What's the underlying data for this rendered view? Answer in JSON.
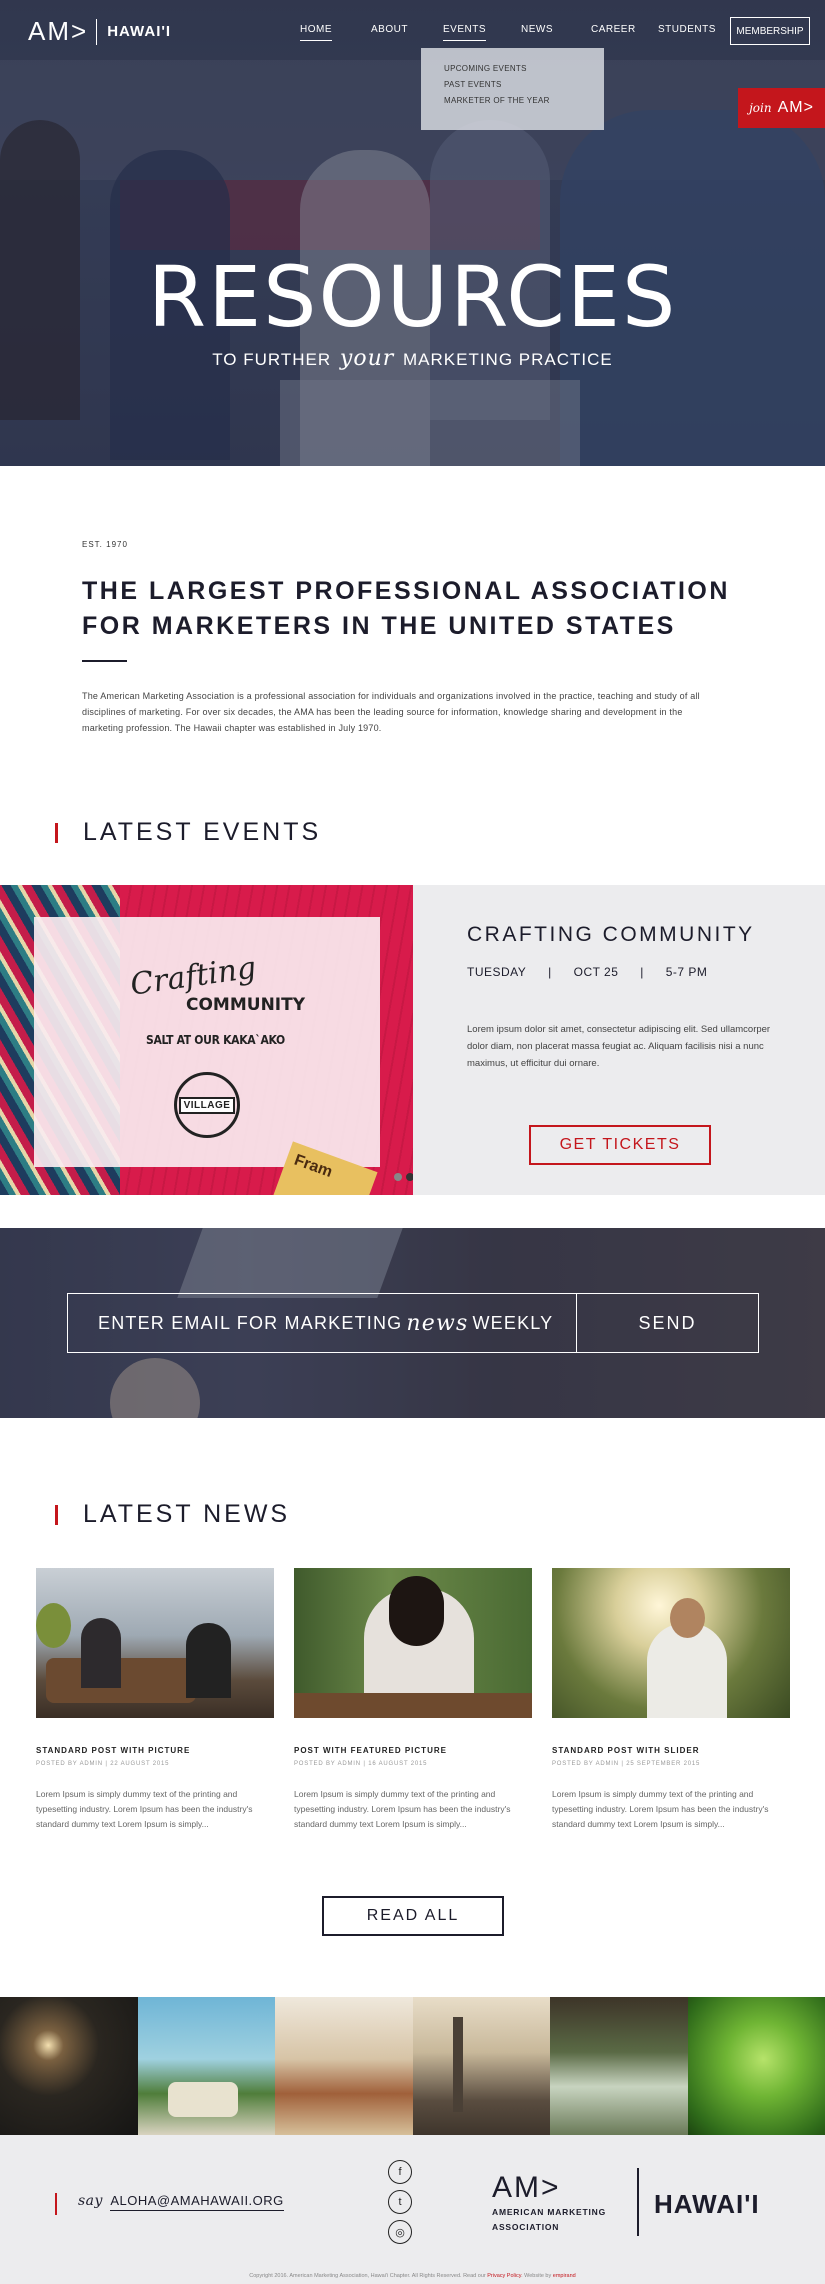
{
  "nav": {
    "logo_am": "AM>",
    "logo_hawaii": "HAWAI'I",
    "items": [
      "HOME",
      "ABOUT",
      "EVENTS",
      "NEWS",
      "CAREER",
      "STUDENTS"
    ],
    "membership": "MEMBERSHIP",
    "events_dropdown": [
      "UPCOMING EVENTS",
      "PAST EVENTS",
      "MARKETER OF THE YEAR"
    ],
    "join_script": "join",
    "join_logo": "AM>"
  },
  "hero": {
    "title": "RESOURCES",
    "sub_before": "TO FURTHER",
    "sub_script": "your",
    "sub_after": "MARKETING PRACTICE"
  },
  "intro": {
    "est": "EST. 1970",
    "heading": "THE LARGEST PROFESSIONAL ASSOCIATION FOR MARKETERS IN THE UNITED STATES",
    "body": "The American Marketing Association is a professional association for individuals and organizations involved in the practice, teaching and study of all disciplines of marketing. For over six decades, the AMA has been the leading source for information, knowledge sharing and development in the marketing profession. The Hawaii chapter was established in July 1970."
  },
  "events": {
    "section_title": "LATEST EVENTS",
    "poster_script": "Crafting",
    "poster_bold": "COMMUNITY",
    "poster_location": "SALT AT OUR KAKA`AKO",
    "poster_badge": "VILLAGE",
    "bottle_text": "Fram",
    "title": "CRAFTING COMMUNITY",
    "day": "TUESDAY",
    "date": "OCT  25",
    "time": "5-7 PM",
    "sep": "|",
    "description": "Lorem ipsum dolor sit amet, consectetur adipiscing elit. Sed ullamcorper dolor diam, non placerat massa feugiat ac. Aliquam facilisis nisi a nunc maximus, ut efficitur dui ornare.",
    "tickets_label": "GET TICKETS"
  },
  "newsletter": {
    "before": "ENTER EMAIL FOR MARKETING",
    "script": "news",
    "after": "WEEKLY",
    "send_label": "SEND"
  },
  "news": {
    "section_title": "LATEST NEWS",
    "posts": [
      {
        "title": "STANDARD POST WITH PICTURE",
        "meta": "POSTED BY ADMIN  |  22 AUGUST 2015",
        "excerpt": "Lorem Ipsum is simply dummy text of the printing and typesetting industry. Lorem Ipsum has been the industry's standard dummy text Lorem Ipsum is simply..."
      },
      {
        "title": "POST WITH FEATURED PICTURE",
        "meta": "POSTED BY ADMIN  |  16 AUGUST 2015",
        "excerpt": "Lorem Ipsum is simply dummy text of the printing and typesetting industry. Lorem Ipsum has been the industry's standard dummy text Lorem Ipsum is simply..."
      },
      {
        "title": "STANDARD POST WITH SLIDER",
        "meta": "POSTED BY ADMIN  |  25 SEPTEMBER 2015",
        "excerpt": "Lorem Ipsum is simply dummy text of the printing and typesetting industry. Lorem Ipsum has been the industry's standard dummy text Lorem Ipsum is simply..."
      }
    ],
    "read_all": "READ ALL"
  },
  "footer": {
    "say": "say",
    "email": "ALOHA@AMAHAWAII.ORG",
    "logo_am": "AM>",
    "logo_line1": "AMERICAN MARKETING",
    "logo_line2": "ASSOCIATION",
    "hawaii": "HAWAI'I",
    "social": [
      "f",
      "t",
      "◎"
    ],
    "copyright_main": "Copyright 2016. American Marketing Association, Hawai'i Chapter. All Rights Reserved. Read our",
    "privacy": "Privacy Policy",
    "copyright_end": ". Website by",
    "credit": "empirand"
  },
  "colors": {
    "accent": "#c4161c",
    "navy": "#1c1c2b",
    "panel": "#ececee"
  },
  "icons": {
    "facebook": "facebook-icon",
    "twitter": "twitter-icon",
    "instagram": "instagram-icon"
  }
}
